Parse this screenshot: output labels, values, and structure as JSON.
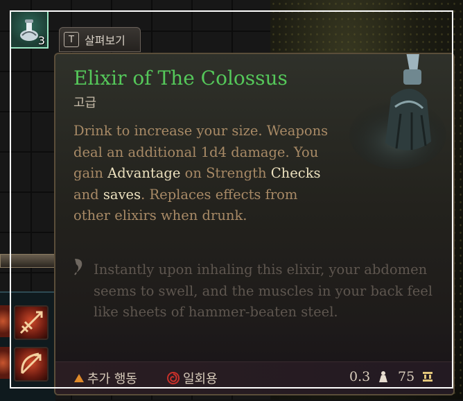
{
  "item_slot": {
    "count": "3"
  },
  "examine_button": {
    "key": "T",
    "label": "살펴보기"
  },
  "tooltip": {
    "title": "Elixir of The Colossus",
    "rarity": "고급",
    "description": {
      "p1": "Drink to increase your size. Weapons deal an additional 1d4 damage. You gain ",
      "kw1": "Advantage",
      "p2": " on Strength ",
      "kw2": "Checks",
      "p3": " and ",
      "kw3": "saves",
      "p4": ". Replaces effects from other elixirs when drunk."
    },
    "flavor_text": "Instantly upon inhaling this elixir, your abdomen seems to swell, and the muscles in your back feel like sheets of hammer-beaten steel.",
    "footer": {
      "action_type": "추가 행동",
      "usage": "일회용",
      "weight": "0.3",
      "value": "75"
    }
  },
  "colors": {
    "title": "#55c85a",
    "keyword": "#ece1bf",
    "description": "#a88a66",
    "flavor": "#5e564f",
    "action_triangle": "#e08a2a",
    "usage_swirl": "#c8302a"
  },
  "icons": [
    "potion-icon",
    "bonus-action-triangle-icon",
    "single-use-swirl-icon",
    "weight-icon",
    "gold-coins-icon",
    "flavor-quill-icon"
  ]
}
